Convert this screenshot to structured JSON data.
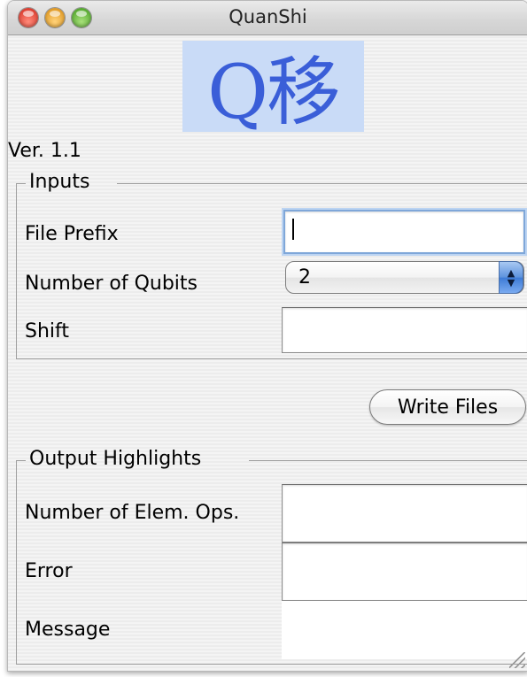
{
  "window": {
    "title": "QuanShi",
    "close_icon": "close-icon",
    "minimize_icon": "minimize-icon",
    "zoom_icon": "zoom-icon"
  },
  "logo": {
    "text": "Q移",
    "background": "#c9dbf7",
    "color": "#3a5ed8"
  },
  "version": "Ver. 1.1",
  "inputs": {
    "legend": "Inputs",
    "file_prefix_label": "File Prefix",
    "file_prefix_value": "",
    "qubits_label": "Number of Qubits",
    "qubits_value": "2",
    "shift_label": "Shift",
    "shift_value": ""
  },
  "write_button_label": "Write Files",
  "output": {
    "legend": "Output Highlights",
    "elem_ops_label": "Number of Elem. Ops.",
    "elem_ops_value": "",
    "error_label": "Error",
    "error_value": "",
    "message_label": "Message",
    "message_value": ""
  },
  "colors": {
    "focus_ring": "#7fa7d9",
    "popup_arrow_blue": "#3d7bd6"
  }
}
